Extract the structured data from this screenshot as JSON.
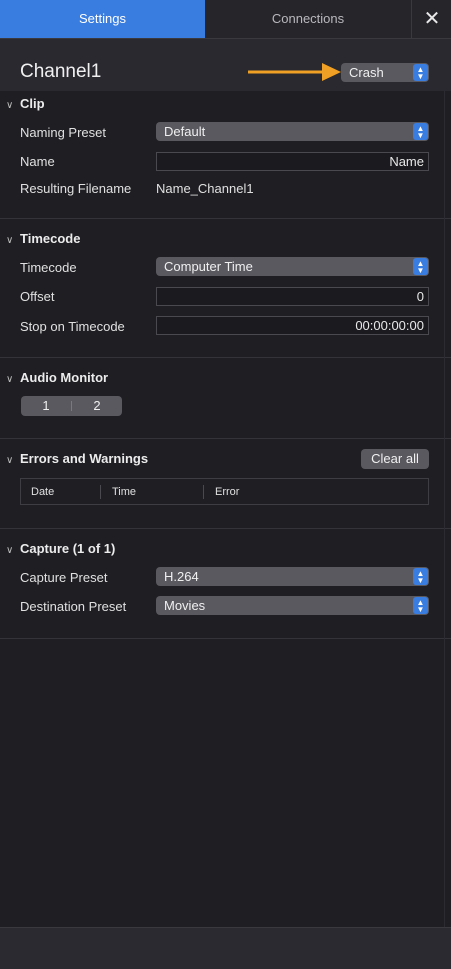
{
  "tabs": {
    "settings": "Settings",
    "connections": "Connections",
    "close": "✕"
  },
  "header": {
    "channel_title": "Channel1",
    "crash_value": "Crash"
  },
  "clip": {
    "title": "Clip",
    "naming_preset_label": "Naming Preset",
    "naming_preset_value": "Default",
    "name_label": "Name",
    "name_value": "Name",
    "resulting_filename_label": "Resulting Filename",
    "resulting_filename_value": "Name_Channel1"
  },
  "timecode": {
    "title": "Timecode",
    "timecode_label": "Timecode",
    "timecode_value": "Computer Time",
    "offset_label": "Offset",
    "offset_value": "0",
    "stop_label": "Stop on Timecode",
    "stop_value": "00:00:00:00"
  },
  "audio_monitor": {
    "title": "Audio Monitor",
    "segments": [
      "1",
      "2"
    ]
  },
  "errors": {
    "title": "Errors and Warnings",
    "clear_label": "Clear all",
    "columns": [
      "Date",
      "Time",
      "Error"
    ]
  },
  "capture": {
    "title": "Capture (1 of 1)",
    "capture_preset_label": "Capture Preset",
    "capture_preset_value": "H.264",
    "destination_preset_label": "Destination Preset",
    "destination_preset_value": "Movies"
  },
  "colors": {
    "accent": "#3a7de0",
    "arrow": "#f0a024",
    "background": "#1f1e23"
  }
}
